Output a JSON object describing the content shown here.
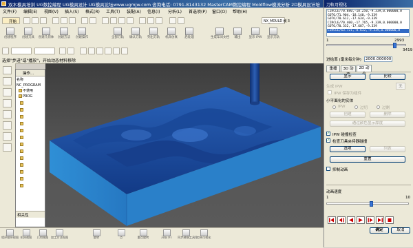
{
  "title_bar": {
    "text": "双木模具培训 UG数控编程 UG模具设计 UG模具论坛www.ugmjw.com 咨询电话: 0791-8143132 MasterCAM数控编程 Moldflow模流分析 2D模具设计培"
  },
  "menubar": {
    "items": [
      "文件(F)",
      "编辑(E)",
      "视图(V)",
      "插入(S)",
      "格式(R)",
      "工具(T)",
      "装配(A)",
      "信息(I)",
      "分析(L)",
      "首选项(P)",
      "窗口(O)",
      "帮助(H)"
    ],
    "start_label": "开始",
    "window_tab": "NX_MOULD 模 3"
  },
  "toolbar_big": [
    "创建程序",
    "创建刀具",
    "创建几何体",
    "创建方法",
    "创建操作",
    "",
    "",
    "全部刀轨",
    "确认刀轨",
    "列出刀轨",
    "机床仿真",
    "后处理",
    "",
    "生成车间文档",
    "输出",
    "显示 IPW",
    "显示刀轨"
  ],
  "prompt": {
    "text": "选择\"步进\"或\"播放\"，开始动态材料移除"
  },
  "navigator": {
    "header": "操作…",
    "rows": [
      "名称",
      "NC_PROGRAM",
      "不使用",
      "PROG",
      "",
      "",
      "",
      "",
      "",
      "",
      "",
      "",
      "",
      "",
      "",
      "",
      "",
      ""
    ],
    "footer": "相关性"
  },
  "bottom_toolbar": [
    "程序顺序视图",
    "机床视图",
    "几何视图",
    "加工方法视图",
    "",
    "旋转",
    "",
    "点",
    "",
    "重点旋转",
    "",
    "",
    "开始 (F)",
    "",
    "同步建模工具条",
    "刀具可视化"
  ],
  "dialog": {
    "title": "刀轨可视化",
    "cl_lines": [
      "CIRCLE/70.880,-18.250,-9.339,0.000000,0",
      "GOTO/71.904,-18.140,-9.339",
      "GOTO/70.612,-17.634,-9.339",
      "CIRCLE/70.400,-17.765,-9.339,0.000000,0",
      "GOTO/70.332,-17.687,-9.339",
      "CIRCLE/63.721,-8.632,-9.339,0.000000,0"
    ],
    "selected_line": 5,
    "slider_min": "1",
    "slider_value": "2993",
    "slider_max": "3419",
    "slider_fraction": 0.875,
    "feed_label": "进给率 (毫米每分钟)",
    "feed_value": "2000.000000",
    "tabs": [
      "重播",
      "3D 动态",
      "2D 动态"
    ],
    "active_tab": "2D 动态",
    "btn_display": "显示",
    "btn_compare": "比较",
    "generate_ipw_label": "生成 IPW",
    "ipw_value": "无",
    "save_ipw_label": "IPW 保存为组件",
    "small_feature_label": "小平面化的实体",
    "radio_ipw": "IPW",
    "radio_over": "过切",
    "radio_remain": "过剩",
    "btn_create": "创建",
    "btn_delete": "删除",
    "btn_thickness": "通过颜色显示厚度",
    "chk_collision_ipw": "IPW 碰撞检查",
    "chk_holder": "检查刀具夹持器碰撞",
    "btn_options": "选项",
    "btn_list": "列表",
    "btn_reset": "重置",
    "chk_suppress": "抑制动画",
    "speed_label": "动画速度",
    "speed_min": "1",
    "speed_max": "10",
    "speed_fraction": 0.55,
    "btn_ok": "确定",
    "btn_cancel": "取消"
  },
  "colors": {
    "part_blue": "#2d86cc",
    "part_dark": "#1f4f9a",
    "viewport_bg": "#4a4a4a",
    "title_blue": "#0a246a"
  }
}
